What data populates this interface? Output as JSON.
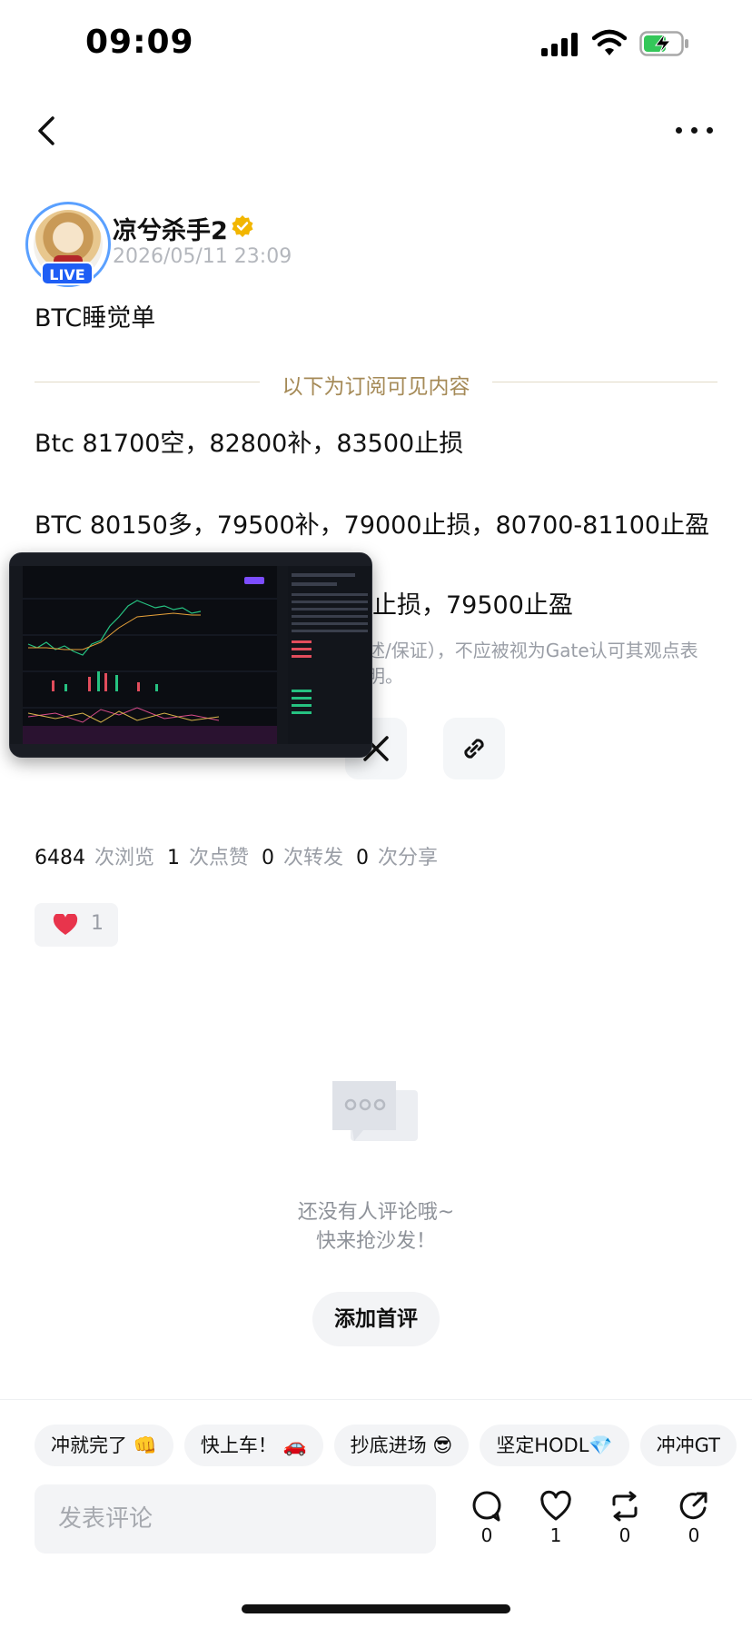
{
  "status_bar": {
    "time": "09:09"
  },
  "author": {
    "name": "凉兮杀手2",
    "live_label": "LIVE",
    "post_time": "2026/05/11 23:09"
  },
  "post": {
    "title": "BTC睡觉单",
    "divider_text": "以下为订阅可见内容",
    "lines": [
      "Btc 81700空，82800补，83500止损",
      "BTC 80150多，79500补，79000止损，80700-81100止盈",
      "止损，79500止盈"
    ],
    "disclaimer_lines": [
      "述/保证），不应被视为Gate认可其观点表",
      "明。"
    ]
  },
  "stats": {
    "views": "6484",
    "views_label": "次浏览",
    "likes": "1",
    "likes_label": "次点赞",
    "reposts": "0",
    "reposts_label": "次转发",
    "shares": "0",
    "shares_label": "次分享"
  },
  "like_chip": {
    "count": "1"
  },
  "empty_state": {
    "line1": "还没有人评论哦~",
    "line2": "快来抢沙发！",
    "button": "添加首评"
  },
  "quick_replies": [
    "冲就完了 👊",
    "快上车！ 🚗",
    "抄底进场 😎",
    "坚定HODL💎",
    "冲冲GT"
  ],
  "comment_bar": {
    "placeholder": "发表评论",
    "comment_count": "0",
    "like_count": "1",
    "repost_count": "0",
    "share_count": "0"
  },
  "icons": {
    "back": "back-arrow-icon",
    "more": "more-icon",
    "verified": "verified-badge-icon",
    "x": "x-logo-icon",
    "link": "link-icon",
    "heart": "heart-icon",
    "comment": "comment-icon",
    "like": "like-icon",
    "repost": "repost-icon",
    "share": "share-icon"
  },
  "colors": {
    "accent_gold": "#a58a57",
    "heart_red": "#e8344c",
    "live_blue": "#1e5ef5",
    "verified_gold": "#f2b600"
  }
}
